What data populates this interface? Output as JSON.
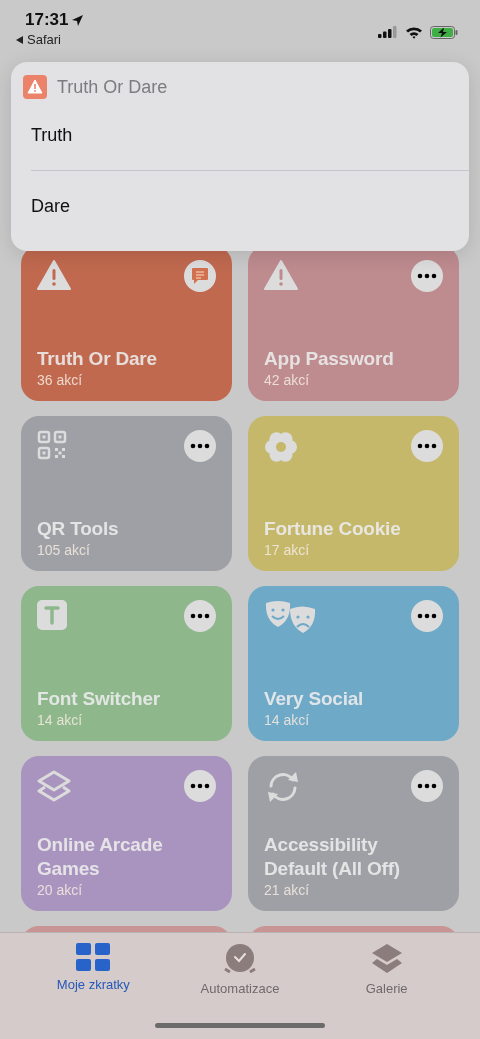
{
  "status_bar": {
    "time": "17:31",
    "back_link": "Safari"
  },
  "menu": {
    "title": "Truth Or Dare",
    "items": [
      {
        "label": "Truth"
      },
      {
        "label": "Dare"
      }
    ]
  },
  "shortcuts": [
    {
      "title": "Truth Or Dare",
      "count": "36 akcí",
      "color": "#c0694f",
      "kind": "warning",
      "button": {
        "kind": "comment"
      }
    },
    {
      "title": "App Password",
      "count": "42 akcí",
      "color": "#be8b8f",
      "kind": "warning",
      "button": {
        "kind": "more"
      }
    },
    {
      "title": "QR Tools",
      "count": "105 akcí",
      "color": "#9ea0a5",
      "kind": "qr",
      "button": {
        "kind": "more"
      }
    },
    {
      "title": "Fortune Cookie",
      "count": "17 akcí",
      "color": "#c5b86b",
      "kind": "flower",
      "button": {
        "kind": "more"
      }
    },
    {
      "title": "Font Switcher",
      "count": "14 akcí",
      "color": "#8eb88c",
      "kind": "text",
      "button": {
        "kind": "more"
      }
    },
    {
      "title": "Very Social",
      "count": "14 akcí",
      "color": "#6ea9c8",
      "kind": "masks",
      "button": {
        "kind": "more"
      }
    },
    {
      "title": "Online Arcade Games",
      "count": "20 akcí",
      "color": "#a994bf",
      "kind": "layers",
      "button": {
        "kind": "more"
      }
    },
    {
      "title": "Accessibility Default (All Off)",
      "count": "21 akcí",
      "color": "#9ea0a5",
      "kind": "sync",
      "button": {
        "kind": "more"
      }
    }
  ],
  "more_cards": [
    {
      "color": "#c99494"
    },
    {
      "color": "#c99494"
    }
  ],
  "tab_bar": [
    {
      "label": "Moje zkratky",
      "selected": true,
      "kind": "grid"
    },
    {
      "label": "Automatizace",
      "selected": false,
      "kind": "clock"
    },
    {
      "label": "Galerie",
      "selected": false,
      "kind": "layers"
    }
  ]
}
